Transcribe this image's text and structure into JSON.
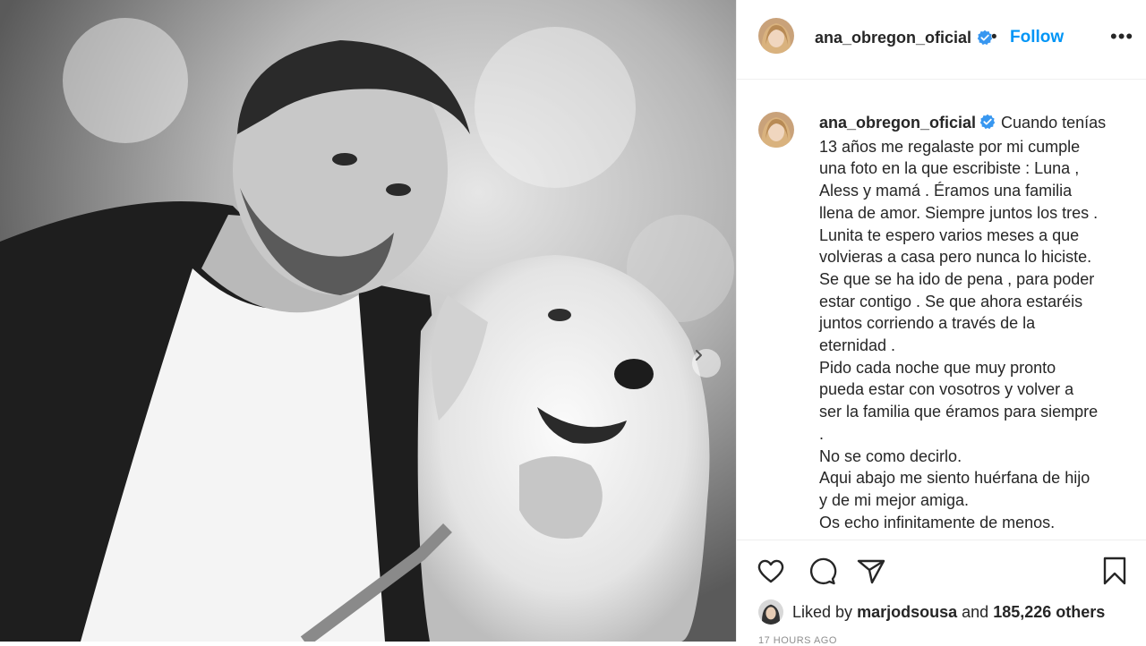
{
  "post": {
    "username": "ana_obregon_oficial",
    "follow_label": "Follow",
    "separator": "•",
    "more_label": "•••",
    "caption_lines": [
      "Cuando tenías",
      "13 años me regalaste por mi cumple",
      "una foto en la que escribiste : Luna ,",
      "Aless y mamá . Éramos una familia",
      "llena de amor. Siempre juntos los tres .",
      "Lunita te espero varios meses a que",
      "volvieras a casa pero nunca lo hiciste.",
      "Se que se ha ido de pena , para poder",
      "estar contigo . Se que ahora estaréis",
      "juntos corriendo a través de la",
      "eternidad .",
      "Pido cada noche que muy pronto",
      "pueda estar con vosotros y volver a",
      "ser la familia que éramos para siempre",
      ".",
      "No se como decirlo.",
      "Aqui abajo me siento huérfana de hijo",
      "y de mi mejor amiga.",
      "Os echo infinitamente de menos."
    ],
    "likes": {
      "prefix": "Liked by",
      "user": "marjodsousa",
      "middle": "and",
      "count": "185,226 others"
    },
    "time_ago": "17 HOURS AGO"
  },
  "icons": {
    "like": "heart-icon",
    "comment": "comment-icon",
    "share": "paper-plane-icon",
    "save": "bookmark-icon",
    "verified": "verified-badge-icon",
    "next": "chevron-right-icon"
  },
  "colors": {
    "accent": "#0095f6",
    "text": "#262626",
    "muted": "#8e8e8e",
    "border": "#efefef"
  }
}
